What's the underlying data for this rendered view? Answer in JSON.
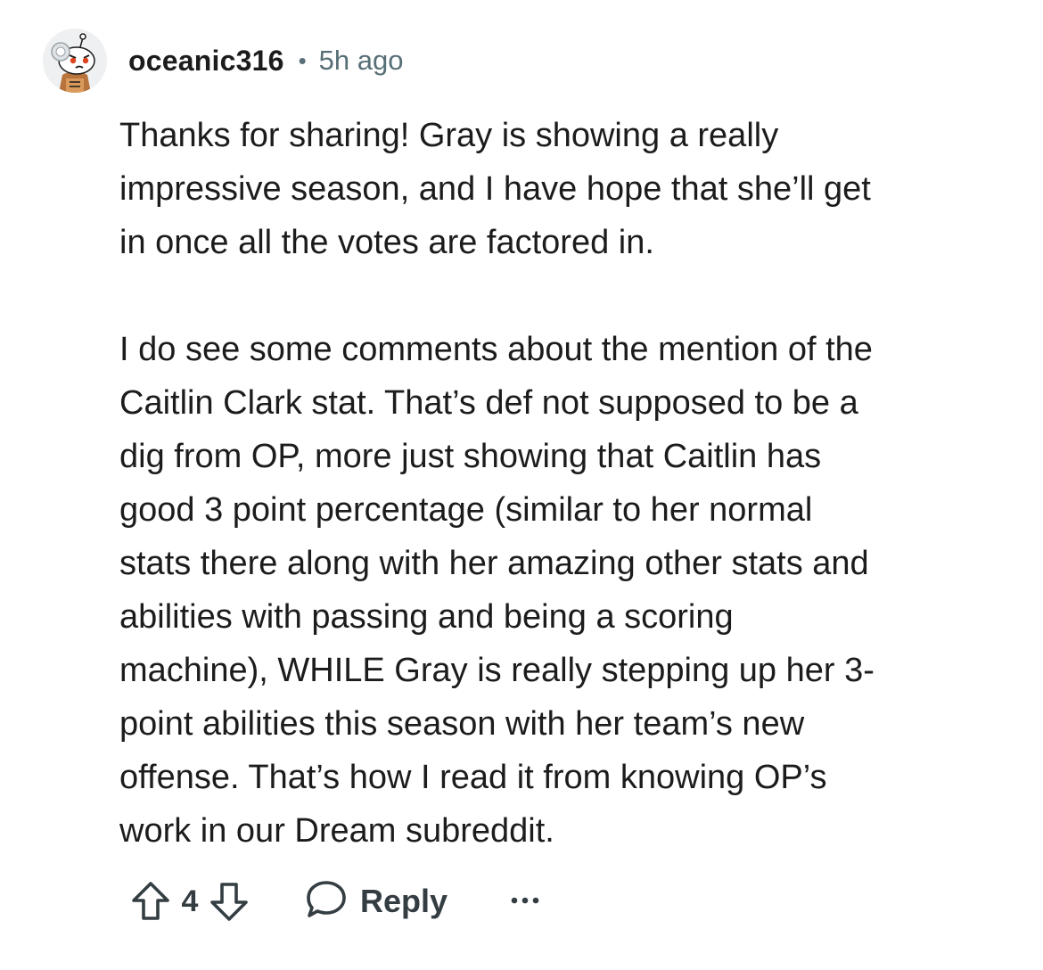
{
  "comment": {
    "author": "oceanic316",
    "separator": "•",
    "time": "5h ago",
    "avatar_icon": "snoo-avatar-icon",
    "paragraphs": [
      "Thanks for sharing! Gray is showing a really\nimpressive season, and I have hope that she’ll get\nin once all the votes are factored in.",
      "I do see some comments about the mention of the\nCaitlin Clark stat. That’s def not supposed to be a\ndig from OP, more just showing that Caitlin has\ngood 3 point percentage (similar to her normal\nstats there along with her amazing other stats and\nabilities with passing and being a scoring\nmachine), WHILE Gray is really stepping up her 3-\npoint abilities this season with her team’s new\noffense. That’s how I read it from knowing OP’s\nwork in our Dream subreddit."
    ]
  },
  "actions": {
    "upvote_icon": "upvote-arrow-icon",
    "vote_count": "4",
    "downvote_icon": "downvote-arrow-icon",
    "reply_icon": "speech-bubble-icon",
    "reply_label": "Reply",
    "more_icon": "ellipsis-icon"
  },
  "colors": {
    "text": "#1c1c1c",
    "meta": "#576f76",
    "action": "#333d42"
  }
}
